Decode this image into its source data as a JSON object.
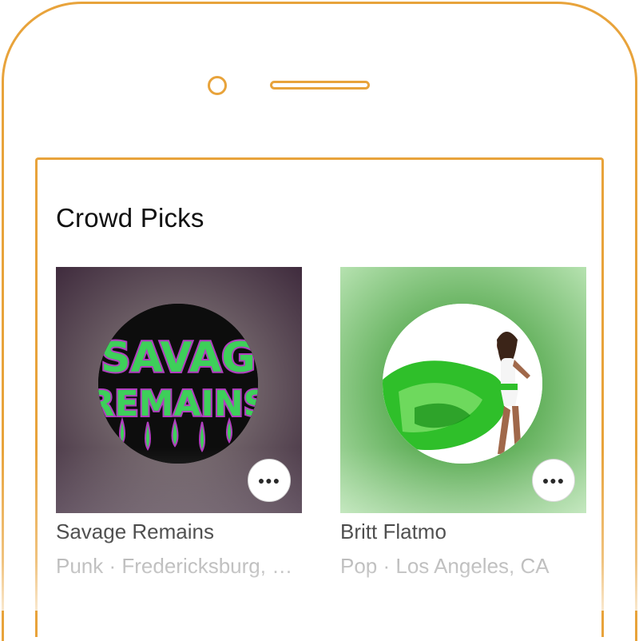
{
  "section": {
    "title": "Crowd Picks"
  },
  "cards": [
    {
      "title": "Savage Remains",
      "subtitle": "Punk · Fredericksburg, VA",
      "logo_text": "SAVAGE REMAINS",
      "menu_icon": "more-horizontal-icon"
    },
    {
      "title": "Britt Flatmo",
      "subtitle": "Pop · Los Angeles, CA",
      "menu_icon": "more-horizontal-icon"
    }
  ],
  "colors": {
    "frame_accent": "#E8A33B",
    "subtitle_gray": "#9A9A9A"
  }
}
